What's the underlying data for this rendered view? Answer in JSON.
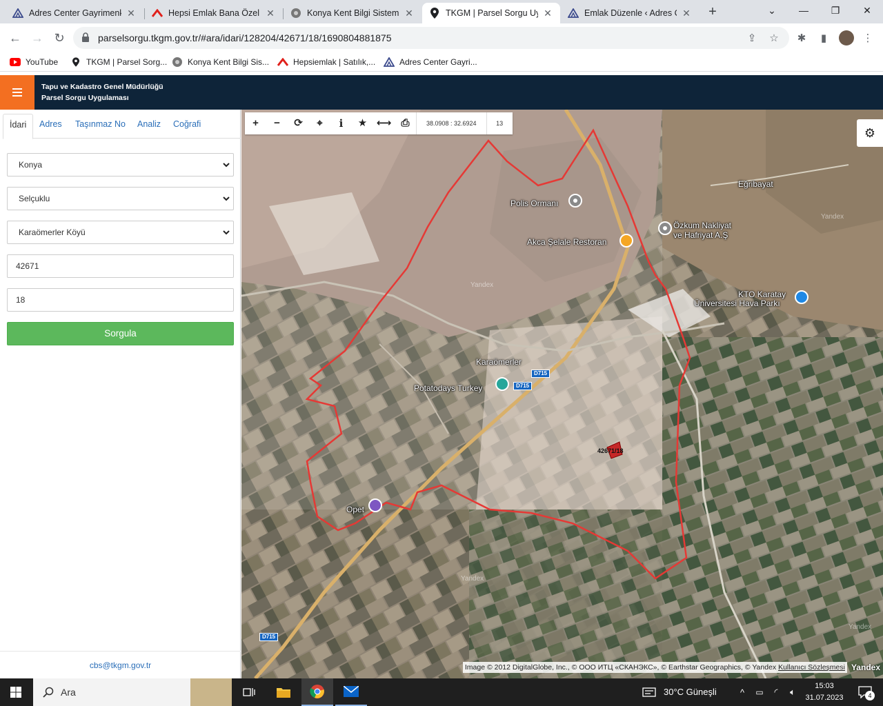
{
  "browser": {
    "tabs": [
      {
        "title": "Adres Center Gayrimenkul",
        "icon": "adres-center-icon"
      },
      {
        "title": "Hepsi Emlak Bana Özel",
        "icon": "hepsiemlak-icon"
      },
      {
        "title": "Konya Kent Bilgi Sistemi",
        "icon": "konya-icon"
      },
      {
        "title": "TKGM | Parsel Sorgu Uygulaması",
        "icon": "location-pin-icon",
        "active": true
      },
      {
        "title": "Emlak Düzenle ‹ Adres Center",
        "icon": "adres-center-icon"
      }
    ],
    "url": "parselsorgu.tkgm.gov.tr/#ara/idari/128204/42671/18/1690804881875",
    "bookmarks": [
      {
        "label": "YouTube",
        "icon": "youtube-icon"
      },
      {
        "label": "TKGM | Parsel Sorg...",
        "icon": "location-pin-icon"
      },
      {
        "label": "Konya Kent Bilgi Sis...",
        "icon": "konya-icon"
      },
      {
        "label": "Hepsiemlak | Satılık,...",
        "icon": "hepsiemlak-icon"
      },
      {
        "label": "Adres Center Gayri...",
        "icon": "adres-center-icon"
      }
    ]
  },
  "app": {
    "title_line1": "Tapu ve Kadastro Genel Müdürlüğü",
    "title_line2": "Parsel Sorgu Uygulaması",
    "accent": "#f36f21",
    "header_bg": "#0e2439"
  },
  "panel": {
    "tabs": [
      "İdari",
      "Adres",
      "Taşınmaz No",
      "Analiz",
      "Coğrafi"
    ],
    "province": "Konya",
    "district": "Selçuklu",
    "neighborhood": "Karaömerler Köyü",
    "block": "42671",
    "parcel": "18",
    "submit_label": "Sorgula",
    "submit_color": "#5cb85c",
    "footer_email": "cbs@tkgm.gov.tr"
  },
  "map": {
    "coords": "38.0908 : 32.6924",
    "zoom": "13",
    "toolbar_icons": [
      "zoom-in-icon",
      "zoom-out-icon",
      "refresh-icon",
      "locate-icon",
      "info-icon",
      "star-icon",
      "measure-icon",
      "print-icon"
    ],
    "attribution": "Image © 2012 DigitalGlobe, Inc., © ООО ИТЦ «СКАНЭКС», © Earthstar Geographics, © Yandex",
    "terms_link": "Kullanıcı Sözleşmesi",
    "provider": "Yandex",
    "parcel_label": "42671/18",
    "boundary_color": "#e53935",
    "labels": {
      "polis": "Polis Ormanı",
      "akca": "Akca Şelale Restoran",
      "ozkum1": "Özkum Nakliyat",
      "ozkum2": "ve Hafriyat A.Ş",
      "egribayat": "Eğribayat",
      "kto1": "KTO Karatay",
      "kto2": "Üniversitesi Hava Parkı",
      "karaomerler": "Karaömerler",
      "potatodays": "Potatodays Turkey",
      "opet": "Opet",
      "watermark": "Yandex"
    },
    "road_badge": "D715"
  },
  "taskbar": {
    "search_placeholder": "Ara",
    "weather": "30°C  Güneşli",
    "time": "15:03",
    "date": "31.07.2023",
    "notifications": "4"
  }
}
